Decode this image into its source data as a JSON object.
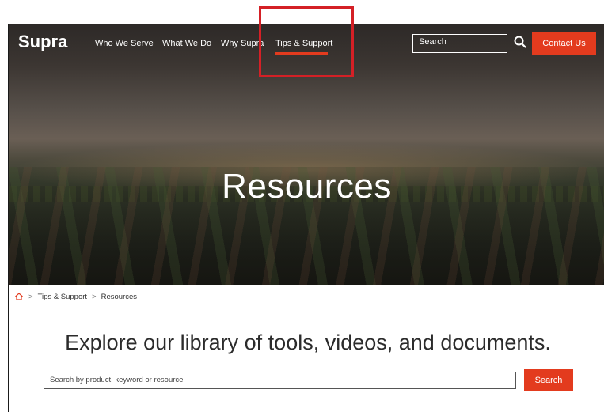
{
  "header": {
    "logo_text": "Supra",
    "nav": [
      {
        "label": "Who We Serve"
      },
      {
        "label": "What We Do"
      },
      {
        "label": "Why Supra"
      },
      {
        "label": "Tips & Support",
        "active": true
      }
    ],
    "search_placeholder": "Search",
    "search_icon": "search-icon",
    "contact_label": "Contact Us"
  },
  "hero": {
    "title": "Resources"
  },
  "breadcrumb": {
    "home_icon": "home-icon",
    "items": [
      "Tips & Support",
      "Resources"
    ],
    "separator": ">"
  },
  "main": {
    "heading": "Explore our library of tools, videos, and documents.",
    "search_placeholder": "Search by product, keyword or resource",
    "search_button": "Search"
  },
  "colors": {
    "accent": "#e33b1e",
    "highlight_box": "#d42026",
    "text_dark": "#2b2b2b"
  }
}
